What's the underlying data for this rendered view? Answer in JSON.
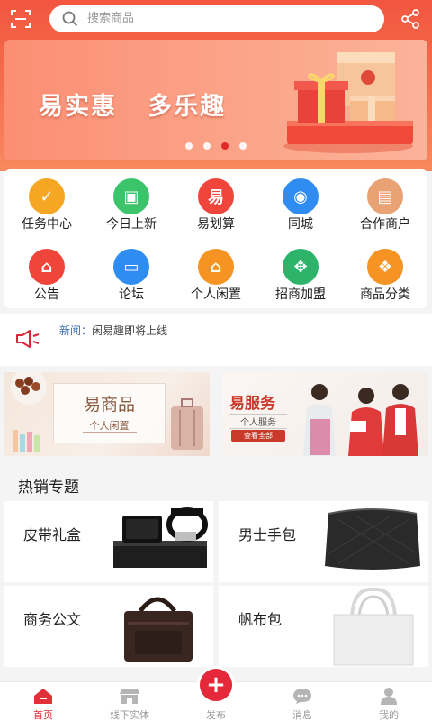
{
  "search": {
    "placeholder": "搜索商品"
  },
  "banner": {
    "slogan": "易实惠   多乐趣",
    "active_dot": 3,
    "dot_count": 4
  },
  "quick_menu": [
    {
      "label": "任务中心",
      "icon": "task-icon",
      "color": "#f5a623"
    },
    {
      "label": "今日上新",
      "icon": "shopping-bag-icon",
      "color": "#3cc46a"
    },
    {
      "label": "易划算",
      "icon": "yi-icon",
      "color": "#f0453a"
    },
    {
      "label": "同城",
      "icon": "location-pin-icon",
      "color": "#2f8cf0"
    },
    {
      "label": "合作商户",
      "icon": "storefront-icon",
      "color": "#e9a273"
    },
    {
      "label": "公告",
      "icon": "announcement-icon",
      "color": "#f0453a"
    },
    {
      "label": "论坛",
      "icon": "forum-icon",
      "color": "#2f8cf0"
    },
    {
      "label": "个人闲置",
      "icon": "idle-goods-icon",
      "color": "#f59323"
    },
    {
      "label": "招商加盟",
      "icon": "handshake-icon",
      "color": "#2db36a"
    },
    {
      "label": "商品分类",
      "icon": "category-icon",
      "color": "#f59323"
    }
  ],
  "news": {
    "prefix": "新闻：",
    "text": "闲易趣即将上线"
  },
  "promos": [
    {
      "title": "易商品",
      "subtitle": "个人闲置"
    },
    {
      "title": "易服务",
      "subtitle": "个人服务",
      "button": "查看全部"
    }
  ],
  "hot": {
    "title": "热销专题",
    "items": [
      {
        "label": "皮带礼盒",
        "image": "belt-gift-box"
      },
      {
        "label": "男士手包",
        "image": "mens-clutch"
      },
      {
        "label": "商务公文",
        "image": "briefcase"
      },
      {
        "label": "帆布包",
        "image": "canvas-bag"
      }
    ]
  },
  "tabs": [
    {
      "label": "首页",
      "icon": "home-icon",
      "active": true
    },
    {
      "label": "线下实体",
      "icon": "store-icon",
      "active": false
    },
    {
      "label": "发布",
      "icon": "plus-icon",
      "active": false
    },
    {
      "label": "消息",
      "icon": "message-icon",
      "active": false
    },
    {
      "label": "我的",
      "icon": "user-icon",
      "active": false
    }
  ],
  "colors": {
    "brand": "#f2563f",
    "tab_active": "#e0303a",
    "fab": "#e6293a"
  }
}
